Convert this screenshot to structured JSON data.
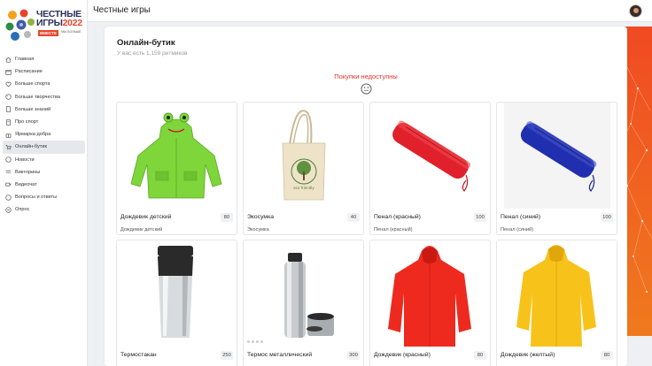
{
  "app": {
    "logo_line1": "ЧЕСТНЫЕ",
    "logo_line2": "ИГРЫ",
    "logo_year": "2022",
    "logo_tag": "ВМЕСТЕ",
    "logo_tag2": "МЫ БОЛЬШЕ"
  },
  "topbar": {
    "title": "Честные игры"
  },
  "sidebar": {
    "items": [
      {
        "label": "Главная",
        "icon": "home-icon"
      },
      {
        "label": "Расписание",
        "icon": "calendar-icon"
      },
      {
        "label": "Больше спорта",
        "icon": "heart-icon"
      },
      {
        "label": "Больше творчества",
        "icon": "palette-icon"
      },
      {
        "label": "Больше знаний",
        "icon": "book-icon"
      },
      {
        "label": "Про спорт",
        "icon": "document-icon"
      },
      {
        "label": "Ярмарка добра",
        "icon": "gift-icon"
      },
      {
        "label": "Онлайн-бутик",
        "icon": "cart-icon"
      },
      {
        "label": "Новости",
        "icon": "news-icon"
      },
      {
        "label": "Викторины",
        "icon": "quiz-icon"
      },
      {
        "label": "Видеочат",
        "icon": "video-icon"
      },
      {
        "label": "Вопросы и ответы",
        "icon": "question-icon"
      },
      {
        "label": "Опрос",
        "icon": "poll-icon"
      }
    ],
    "active_index": 7
  },
  "main": {
    "title": "Онлайн-бутик",
    "subtitle": "У вас есть 1,159 ритмиков",
    "notice": "Покупки недоступны",
    "products": [
      {
        "name": "Дождевик детский",
        "price": "80",
        "desc": "Дождевик детский",
        "image": "green-kids-raincoat"
      },
      {
        "name": "Экосумка",
        "price": "40",
        "desc": "Экосумка",
        "image": "canvas-tote-bag"
      },
      {
        "name": "Пенал (красный)",
        "price": "100",
        "desc": "Пенал (красный)",
        "image": "red-pencil-case"
      },
      {
        "name": "Пенал (синий)",
        "price": "100",
        "desc": "Пенал (синий)",
        "image": "blue-pencil-case"
      },
      {
        "name": "Термостакан",
        "price": "250",
        "desc": "",
        "image": "thermo-mug"
      },
      {
        "name": "Термос металлический",
        "price": "300",
        "desc": "",
        "image": "metal-thermos"
      },
      {
        "name": "Дождевик (красный)",
        "price": "80",
        "desc": "",
        "image": "red-raincoat"
      },
      {
        "name": "Дождевик (желтый)",
        "price": "80",
        "desc": "",
        "image": "yellow-raincoat"
      }
    ]
  },
  "colors": {
    "accent_red": "#e2362b",
    "decor_orange": "#f04a22",
    "logo_navy": "#2b2e5a"
  }
}
